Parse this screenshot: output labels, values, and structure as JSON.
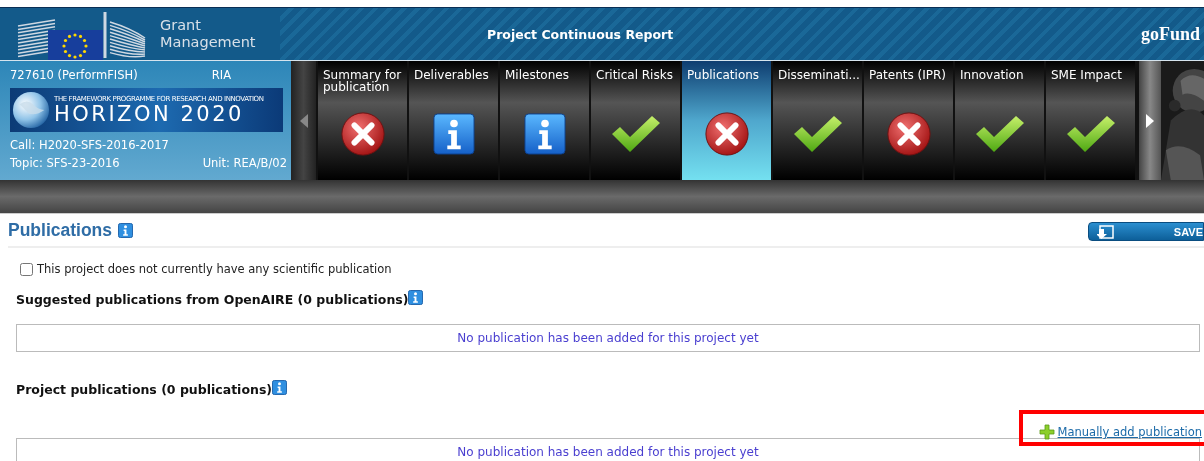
{
  "header": {
    "app_title": [
      "Grant",
      "Management"
    ],
    "report_title": "Project Continuous Report",
    "logo": {
      "name": "goFund"
    }
  },
  "project": {
    "id": "727610 (PerformFISH)",
    "type": "RIA",
    "banner": {
      "tagline": "THE FRAMEWORK PROGRAMME FOR RESEARCH AND INNOVATION",
      "name": "HORIZON 2020"
    },
    "call": "Call: H2020-SFS-2016-2017",
    "topic": "Topic: SFS-23-2016",
    "unit": "Unit: REA/B/02"
  },
  "tabs": [
    {
      "label": "Summary for publication",
      "kind": "error",
      "selected": false
    },
    {
      "label": "Deliverables",
      "kind": "info",
      "selected": false
    },
    {
      "label": "Milestones",
      "kind": "info",
      "selected": false
    },
    {
      "label": "Critical Risks",
      "kind": "ok",
      "selected": false
    },
    {
      "label": "Publications",
      "kind": "error",
      "selected": true
    },
    {
      "label": "Disseminati...",
      "kind": "ok",
      "selected": false
    },
    {
      "label": "Patents (IPR)",
      "kind": "error",
      "selected": false
    },
    {
      "label": "Innovation",
      "kind": "ok",
      "selected": false
    },
    {
      "label": "SME Impact",
      "kind": "ok",
      "selected": false
    }
  ],
  "page": {
    "title": "Publications",
    "save_button": "SAVE",
    "no_publication_checkbox": {
      "label": "This project does not currently have any scientific publication",
      "checked": false
    },
    "sections": [
      {
        "heading": "Suggested publications from OpenAIRE (0 publications)",
        "empty_message": "No publication has been added for this project yet"
      },
      {
        "heading": "Project publications (0 publications)",
        "add_link": "Manually add publication",
        "highlighted": true,
        "empty_message": "No publication has been added for this project yet"
      }
    ]
  }
}
